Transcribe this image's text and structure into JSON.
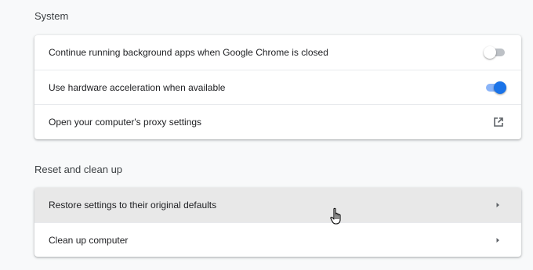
{
  "system": {
    "title": "System",
    "rows": [
      {
        "label": "Continue running background apps when Google Chrome is closed",
        "control": "toggle",
        "enabled": false
      },
      {
        "label": "Use hardware acceleration when available",
        "control": "toggle",
        "enabled": true
      },
      {
        "label": "Open your computer's proxy settings",
        "control": "external-link-icon"
      }
    ]
  },
  "reset": {
    "title": "Reset and clean up",
    "rows": [
      {
        "label": "Restore settings to their original defaults",
        "control": "arrow-right-icon",
        "hovered": true
      },
      {
        "label": "Clean up computer",
        "control": "arrow-right-icon"
      }
    ]
  },
  "colors": {
    "accent": "#1a73e8",
    "accent_track": "#8ab4f8",
    "hover_row": "#e8e8e8",
    "page_bg": "#f8f9fa"
  },
  "cursor": "hand-pointer-icon"
}
